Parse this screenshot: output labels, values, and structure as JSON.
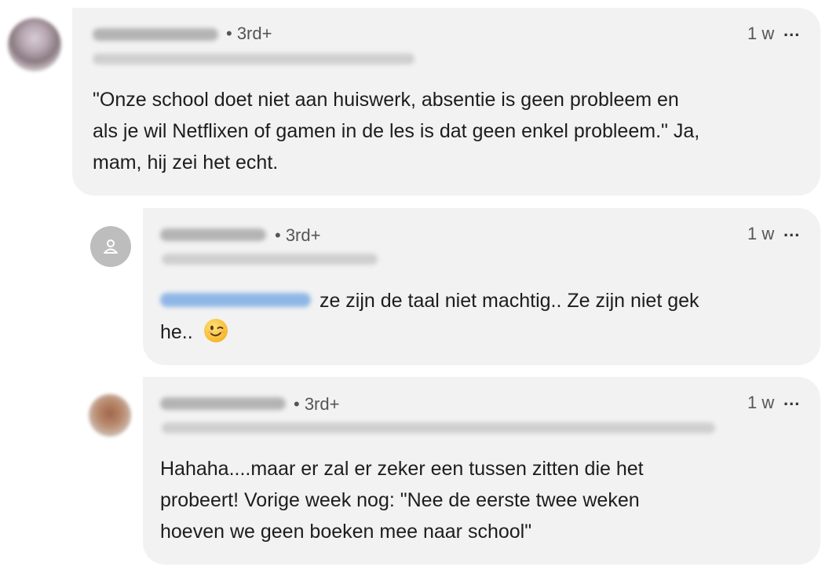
{
  "comments": [
    {
      "degree": "• 3rd+",
      "time": "1 w",
      "more": "...",
      "text": "\"Onze school doet niet aan huiswerk, absentie is geen probleem en\nals je wil Netflixen of gamen in de les is dat geen enkel probleem.\" Ja,\nmam, hij zei het echt."
    },
    {
      "degree": "• 3rd+",
      "time": "1 w",
      "more": "...",
      "text_after_mention": " ze zijn de taal niet machtig.. Ze zijn niet gek",
      "text_line2": "he.. "
    },
    {
      "degree": "• 3rd+",
      "time": "1 w",
      "more": "...",
      "text": "Hahaha....maar er zal er zeker een tussen zitten die het\nprobeert! Vorige week nog: \"Nee de eerste twee weken\nhoeven we geen boeken mee naar school\""
    }
  ],
  "icons": {
    "placeholder_avatar": "person-icon",
    "emoji": "winking-face-icon"
  },
  "colors": {
    "bubble": "#f2f2f2",
    "mention": "#0a66c2",
    "muted_text": "#555555"
  }
}
